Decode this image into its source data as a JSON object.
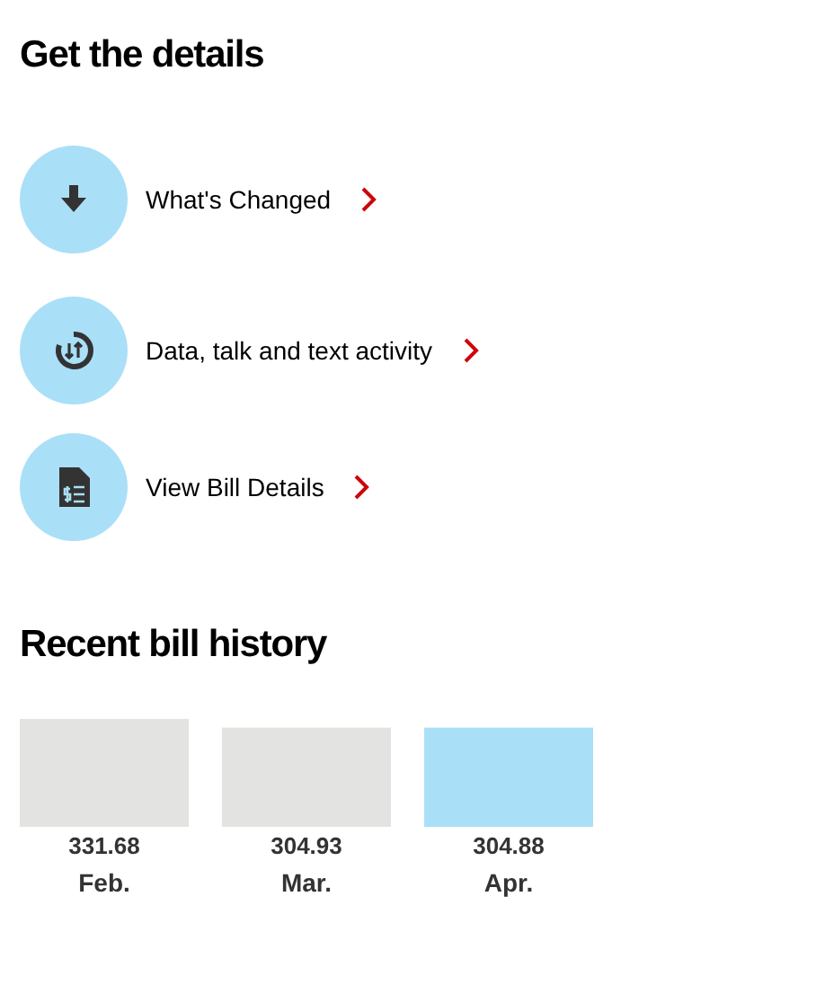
{
  "details": {
    "title": "Get the details",
    "links": [
      {
        "kind": "download",
        "label": "What's Changed"
      },
      {
        "kind": "activity",
        "label": "Data, talk and text activity"
      },
      {
        "kind": "bill",
        "label": "View Bill Details"
      }
    ]
  },
  "history": {
    "title": "Recent bill history",
    "chart_data": {
      "type": "bar",
      "categories": [
        "Feb.",
        "Mar.",
        "Apr."
      ],
      "values": [
        331.68,
        304.93,
        304.88
      ],
      "value_labels": [
        "331.68",
        "304.93",
        "304.88"
      ],
      "data_labels": true
    },
    "bills": [
      {
        "selected": false
      },
      {
        "selected": false
      },
      {
        "selected": true
      }
    ]
  }
}
